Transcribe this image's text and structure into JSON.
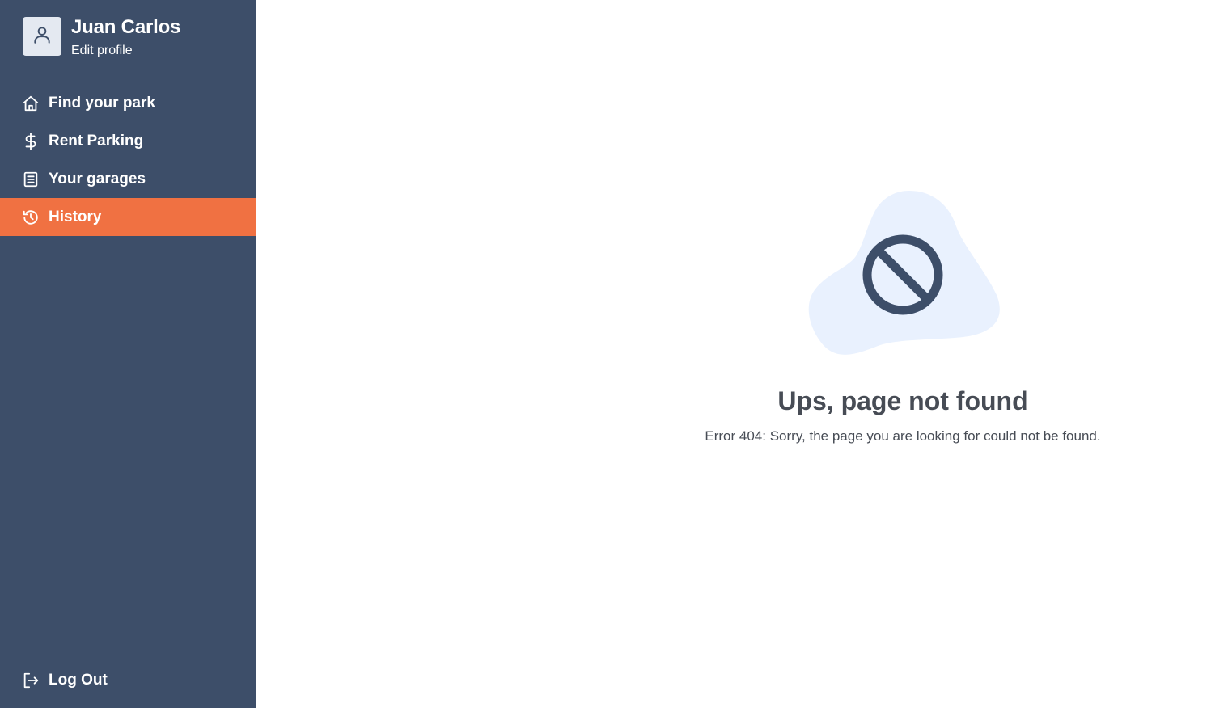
{
  "profile": {
    "name": "Juan Carlos",
    "edit_label": "Edit profile"
  },
  "nav": {
    "items": [
      {
        "label": "Find your park",
        "icon": "home-icon",
        "active": false
      },
      {
        "label": "Rent Parking",
        "icon": "dollar-icon",
        "active": false
      },
      {
        "label": "Your garages",
        "icon": "document-icon",
        "active": false
      },
      {
        "label": "History",
        "icon": "history-icon",
        "active": true
      }
    ],
    "logout_label": "Log Out"
  },
  "error": {
    "title": "Ups, page not found",
    "message": "Error 404: Sorry, the page you are looking for could not be found.",
    "icon": "ban-icon"
  },
  "colors": {
    "sidebar": "#3d4e69",
    "active": "#f07142",
    "blob": "#e9f1fe",
    "text": "#474c55"
  }
}
